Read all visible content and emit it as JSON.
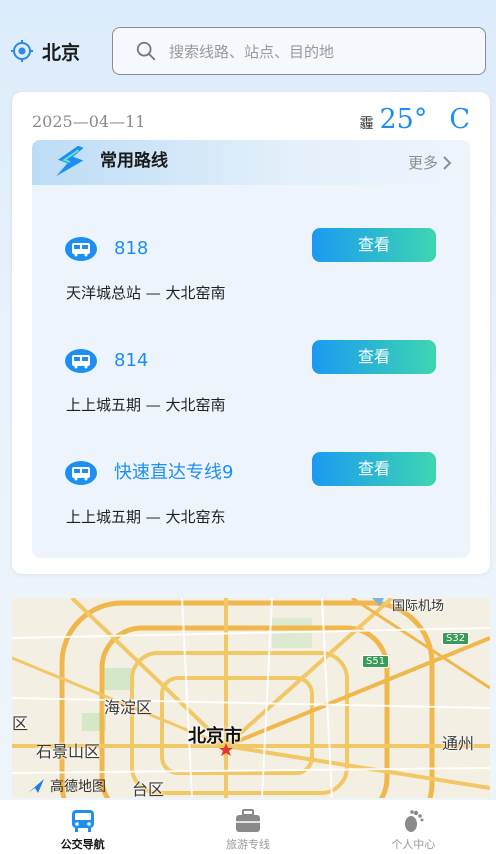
{
  "header": {
    "city": "北京",
    "search_placeholder": "搜索线路、站点、目的地"
  },
  "info": {
    "date": "2025—04—11",
    "weather_condition": "霾",
    "temperature": "25°",
    "temperature_unit": "C"
  },
  "routes_section": {
    "title": "常用路线",
    "more_label": "更多",
    "routes": [
      {
        "name": "818",
        "stops": "天洋城总站 — 大北窑南",
        "button": "查看"
      },
      {
        "name": "814",
        "stops": "上上城五期 — 大北窑南",
        "button": "查看"
      },
      {
        "name": "快速直达专线9",
        "stops": "上上城五期 — 大北窑东",
        "button": "查看"
      }
    ]
  },
  "map": {
    "labels": {
      "airport": "国际机场",
      "haidian": "海淀区",
      "district_left": "区",
      "shijingshan": "石景山区",
      "beijing_city": "北京市",
      "tongzhou": "通州",
      "fengtai": "台区",
      "amap_logo": "高德地图"
    },
    "badges": {
      "s32": "S32",
      "s51": "S51"
    }
  },
  "nav": {
    "items": [
      {
        "label": "公交导航",
        "icon": "bus-icon",
        "active": true
      },
      {
        "label": "旅游专线",
        "icon": "briefcase-icon",
        "active": false
      },
      {
        "label": "个人中心",
        "icon": "footprint-icon",
        "active": false
      }
    ]
  },
  "colors": {
    "accent": "#1e8ff0",
    "button_start": "#1a9af2",
    "button_end": "#3dd6b0"
  }
}
